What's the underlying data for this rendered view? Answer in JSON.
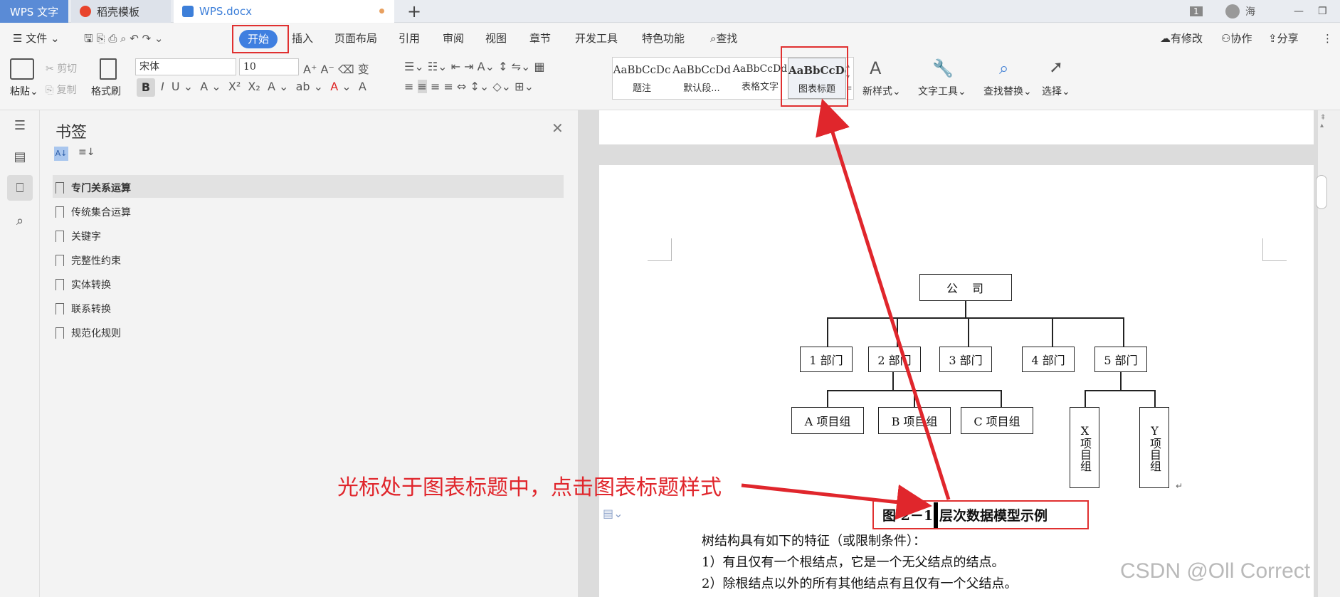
{
  "titlebar": {
    "app_tab": "WPS 文字",
    "tabs": [
      {
        "label": "稻壳模板"
      },
      {
        "label": "WPS.docx"
      }
    ],
    "new_tab": "+",
    "window_count": "1",
    "user": "海"
  },
  "menu": {
    "file": "文件",
    "items": [
      "开始",
      "插入",
      "页面布局",
      "引用",
      "审阅",
      "视图",
      "章节",
      "开发工具",
      "特色功能"
    ],
    "search": "查找",
    "right": [
      "有修改",
      "协作",
      "分享"
    ]
  },
  "ribbon": {
    "paste": "粘贴",
    "cut": "剪切",
    "copy": "复制",
    "format_painter": "格式刷",
    "font_name": "宋体",
    "font_size": "10",
    "styles": [
      {
        "preview": "AaBbCcDc",
        "name": "题注"
      },
      {
        "preview": "AaBbCcDd",
        "name": "默认段..."
      },
      {
        "preview": "AaBbCcDd",
        "name": "表格文字"
      },
      {
        "preview": "AaBbCcDc",
        "name": "图表标题"
      }
    ],
    "new_style": "新样式",
    "text_tools": "文字工具",
    "find_replace": "查找替换",
    "select": "选择"
  },
  "bookmarks": {
    "title": "书签",
    "items": [
      "专门关系运算",
      "传统集合运算",
      "关键字",
      "完整性约束",
      "实体转换",
      "联系转换",
      "规范化规则"
    ]
  },
  "diagram": {
    "root": "公　司",
    "depts": [
      "1 部门",
      "2 部门",
      "3 部门",
      "4 部门",
      "5 部门"
    ],
    "groups": [
      "A 项目组",
      "B 项目组",
      "C 项目组"
    ],
    "vgroups": [
      "X项目组",
      "Y项目组"
    ]
  },
  "document": {
    "caption_prefix": "图·2－1",
    "caption_text": "层次数据模型示例",
    "lines": [
      "树结构具有如下的特征（或限制条件）：",
      "1）有且仅有一个根结点，它是一个无父结点的结点。",
      "2）除根结点以外的所有其他结点有且仅有一个父结点。"
    ]
  },
  "annotation": "光标处于图表标题中，点击图表标题样式",
  "watermark": "CSDN @Oll Correct",
  "colors": {
    "accent": "#3f7fe0",
    "annotation": "#e0262c"
  }
}
